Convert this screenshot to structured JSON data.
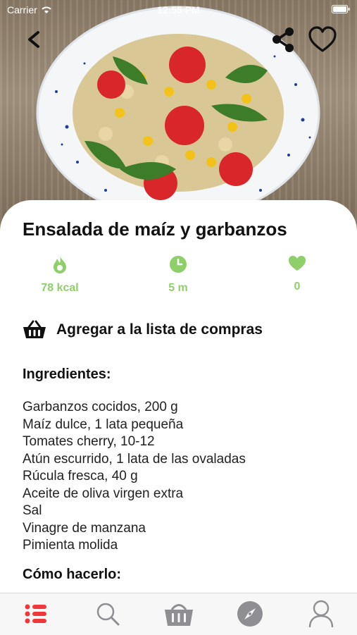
{
  "status_bar": {
    "carrier": "Carrier",
    "time": "12:55 PM"
  },
  "recipe": {
    "title": "Ensalada de maíz y garbanzos",
    "stats": [
      {
        "icon": "flame-icon",
        "value": "78 kcal"
      },
      {
        "icon": "clock-icon",
        "value": "5 m"
      },
      {
        "icon": "heart-icon",
        "value": "0"
      }
    ],
    "add_to_cart_label": "Agregar a la lista de compras",
    "ingredients_title": "Ingredientes:",
    "ingredients": [
      "Garbanzos cocidos, 200 g",
      "Maíz dulce, 1 lata pequeña",
      "Tomates cherry, 10-12",
      "Atún escurrido, 1 lata de las ovaladas",
      "Rúcula fresca, 40 g",
      "Aceite de oliva virgen extra",
      "Sal",
      "Vinagre de manzana",
      "Pimienta molida"
    ],
    "how_to_title": "Cómo hacerlo:"
  },
  "tabs": [
    {
      "icon": "list-icon",
      "active": true
    },
    {
      "icon": "search-icon",
      "active": false
    },
    {
      "icon": "basket-icon",
      "active": false
    },
    {
      "icon": "compass-icon",
      "active": false
    },
    {
      "icon": "profile-icon",
      "active": false
    }
  ],
  "colors": {
    "accent_green": "#8fcf6a",
    "active_tab_red": "#f0373a",
    "inactive_tab": "#8e8e93"
  }
}
